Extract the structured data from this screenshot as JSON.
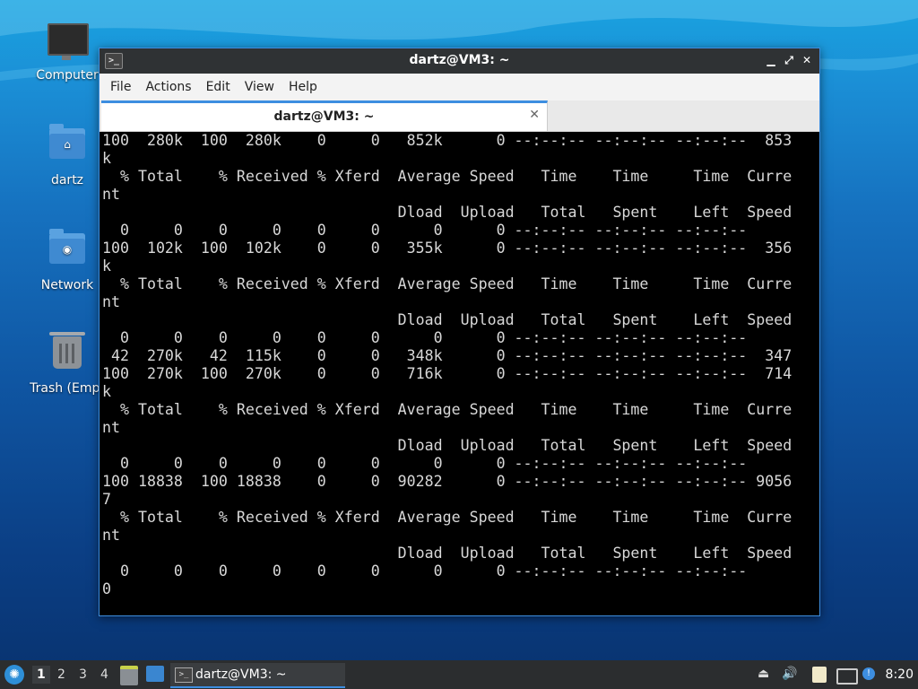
{
  "desktop": {
    "icons": [
      {
        "label": "Computer"
      },
      {
        "label": "dartz"
      },
      {
        "label": "Network"
      },
      {
        "label": "Trash (Empt"
      }
    ]
  },
  "window": {
    "title": "dartz@VM3: ~",
    "menu": [
      "File",
      "Actions",
      "Edit",
      "View",
      "Help"
    ],
    "tab_label": "dartz@VM3: ~",
    "terminal_lines": [
      "100  280k  100  280k    0     0   852k      0 --:--:-- --:--:-- --:--:--  853",
      "k",
      "  % Total    % Received % Xferd  Average Speed   Time    Time     Time  Curre",
      "nt",
      "                                 Dload  Upload   Total   Spent    Left  Speed",
      "  0     0    0     0    0     0      0      0 --:--:-- --:--:-- --:--:--",
      "100  102k  100  102k    0     0   355k      0 --:--:-- --:--:-- --:--:--  356",
      "k",
      "  % Total    % Received % Xferd  Average Speed   Time    Time     Time  Curre",
      "nt",
      "                                 Dload  Upload   Total   Spent    Left  Speed",
      "  0     0    0     0    0     0      0      0 --:--:-- --:--:-- --:--:--",
      " 42  270k   42  115k    0     0   348k      0 --:--:-- --:--:-- --:--:--  347",
      "100  270k  100  270k    0     0   716k      0 --:--:-- --:--:-- --:--:--  714",
      "k",
      "  % Total    % Received % Xferd  Average Speed   Time    Time     Time  Curre",
      "nt",
      "                                 Dload  Upload   Total   Spent    Left  Speed",
      "  0     0    0     0    0     0      0      0 --:--:-- --:--:-- --:--:--",
      "100 18838  100 18838    0     0  90282      0 --:--:-- --:--:-- --:--:-- 9056",
      "7",
      "  % Total    % Received % Xferd  Average Speed   Time    Time     Time  Curre",
      "nt",
      "                                 Dload  Upload   Total   Spent    Left  Speed",
      "  0     0    0     0    0     0      0      0 --:--:-- --:--:-- --:--:--",
      "0"
    ]
  },
  "taskbar": {
    "workspaces": [
      "1",
      "2",
      "3",
      "4"
    ],
    "active_task": "dartz@VM3: ~",
    "clock": "8:20"
  }
}
